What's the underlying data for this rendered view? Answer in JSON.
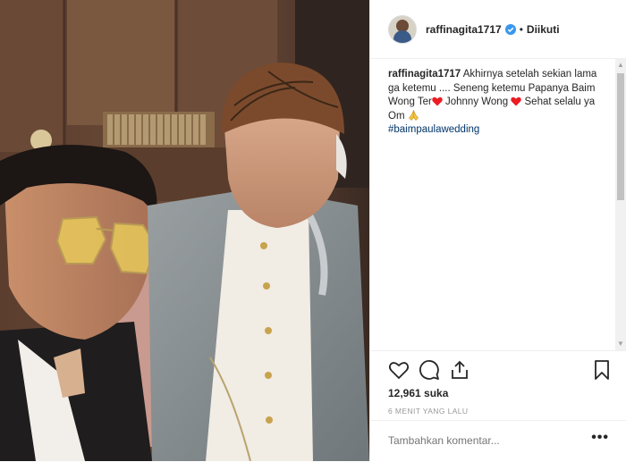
{
  "photo": {
    "description_icon": "photo-image"
  },
  "header": {
    "username": "raffinagita1717",
    "separator": "•",
    "follow_status": "Diikuti"
  },
  "caption": {
    "username": "raffinagita1717",
    "line1": "Akhirnya setelah sekian lama ga ketemu .... Seneng ketemu Papanya Baim Wong Ter",
    "line2": " Johnny Wong ",
    "line3": " Sehat selalu ya Om ",
    "hashtag": "#baimpaulawedding"
  },
  "actions": {
    "likes": "12,961 suka",
    "time": "6 MENIT YANG LALU",
    "comment_placeholder": "Tambahkan komentar...",
    "more": "•••"
  },
  "colors": {
    "verified": "#3897f0",
    "heart": "#ed1c24",
    "hashtag": "#003569"
  }
}
